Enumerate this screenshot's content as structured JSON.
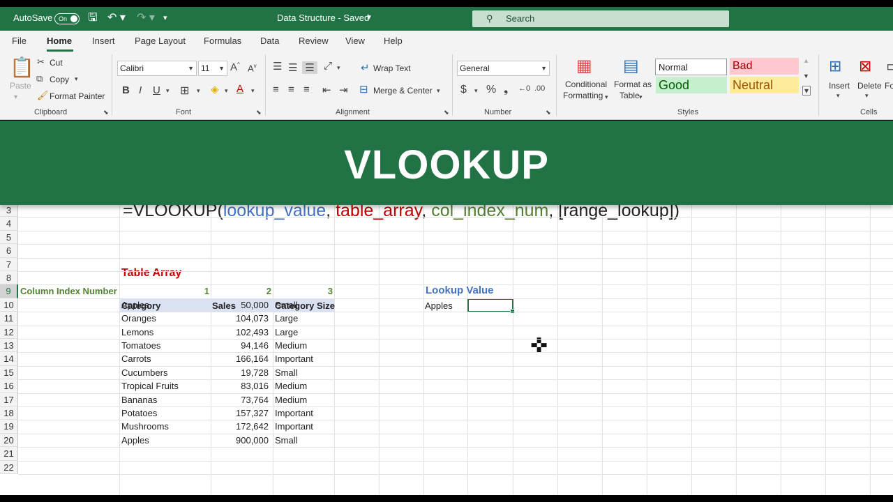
{
  "titlebar": {
    "autosave_label": "AutoSave",
    "autosave_state": "On",
    "document_title": "Data Structure  -  Saved",
    "search_placeholder": "Search"
  },
  "menu": {
    "tabs": [
      "File",
      "Home",
      "Insert",
      "Page Layout",
      "Formulas",
      "Data",
      "Review",
      "View",
      "Help"
    ],
    "active": "Home"
  },
  "ribbon": {
    "clipboard": {
      "paste": "Paste",
      "cut": "Cut",
      "copy": "Copy",
      "format_painter": "Format Painter",
      "group": "Clipboard"
    },
    "font": {
      "name": "Calibri",
      "size": "11",
      "group": "Font"
    },
    "alignment": {
      "wrap": "Wrap Text",
      "merge": "Merge & Center",
      "group": "Alignment"
    },
    "number": {
      "format": "General",
      "group": "Number"
    },
    "styles": {
      "conditional_1": "Conditional",
      "conditional_2": "Formatting",
      "format_table_1": "Format as",
      "format_table_2": "Table",
      "normal": "Normal",
      "bad": "Bad",
      "good": "Good",
      "neutral": "Neutral",
      "group": "Styles"
    },
    "cells": {
      "insert": "Insert",
      "delete": "Delete",
      "format_partial": "Fo",
      "group": "Cells"
    }
  },
  "banner": {
    "title": "VLOOKUP"
  },
  "sheet": {
    "row_numbers": [
      "3",
      "4",
      "5",
      "6",
      "7",
      "8",
      "9",
      "10",
      "11",
      "12",
      "13",
      "14",
      "15",
      "16",
      "17",
      "18",
      "19",
      "20",
      "21",
      "22"
    ],
    "formula": {
      "prefix": "=VLOOKUP(",
      "arg1": "lookup_value",
      "sep1": ", ",
      "arg2": "table_array",
      "sep2": ", ",
      "arg3": "col_index_num",
      "sep3": ", ",
      "arg4": "[range_lookup])"
    },
    "table_array_label": "Table Array",
    "column_index_label": "Column Index Number",
    "column_indexes": [
      "1",
      "2",
      "3"
    ],
    "lookup_value_label": "Lookup Value",
    "lookup_value": "Apples",
    "headers": [
      "Category",
      "Sales",
      "Category Size"
    ],
    "rows": [
      [
        "Apples",
        "50,000",
        "Small"
      ],
      [
        "Oranges",
        "104,073",
        "Large"
      ],
      [
        "Lemons",
        "102,493",
        "Large"
      ],
      [
        "Tomatoes",
        "94,146",
        "Medium"
      ],
      [
        "Carrots",
        "166,164",
        "Important"
      ],
      [
        "Cucumbers",
        "19,728",
        "Small"
      ],
      [
        "Tropical Fruits",
        "83,016",
        "Medium"
      ],
      [
        "Bananas",
        "73,764",
        "Medium"
      ],
      [
        "Potatoes",
        "157,327",
        "Important"
      ],
      [
        "Mushrooms",
        "172,642",
        "Important"
      ],
      [
        "Apples",
        "900,000",
        "Small"
      ]
    ]
  },
  "colors": {
    "brand": "#217346",
    "table_header_fill": "#d9e1f2",
    "index_green": "#548235",
    "title_red": "#c00000",
    "lookup_blue": "#4472c4"
  }
}
